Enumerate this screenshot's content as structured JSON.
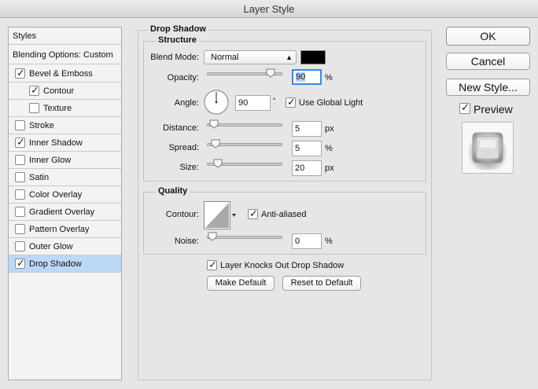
{
  "window": {
    "title": "Layer Style"
  },
  "styles_panel": {
    "header": "Styles",
    "blending": "Blending Options: Custom",
    "items": [
      {
        "label": "Bevel & Emboss",
        "checked": true
      },
      {
        "label": "Contour",
        "checked": true
      },
      {
        "label": "Texture",
        "checked": false
      },
      {
        "label": "Stroke",
        "checked": false
      },
      {
        "label": "Inner Shadow",
        "checked": true
      },
      {
        "label": "Inner Glow",
        "checked": false
      },
      {
        "label": "Satin",
        "checked": false
      },
      {
        "label": "Color Overlay",
        "checked": false
      },
      {
        "label": "Gradient Overlay",
        "checked": false
      },
      {
        "label": "Pattern Overlay",
        "checked": false
      },
      {
        "label": "Outer Glow",
        "checked": false
      },
      {
        "label": "Drop Shadow",
        "checked": true,
        "selected": true
      }
    ]
  },
  "drop_shadow": {
    "title": "Drop Shadow",
    "structure": {
      "title": "Structure",
      "blend_mode_label": "Blend Mode:",
      "blend_mode_value": "Normal",
      "shadow_color": "#000000",
      "opacity_label": "Opacity:",
      "opacity_value": "90",
      "opacity_unit": "%",
      "angle_label": "Angle:",
      "angle_value": "90",
      "angle_unit": "°",
      "use_global_light_label": "Use Global Light",
      "use_global_light_checked": true,
      "distance_label": "Distance:",
      "distance_value": "5",
      "distance_unit": "px",
      "spread_label": "Spread:",
      "spread_value": "5",
      "spread_unit": "%",
      "size_label": "Size:",
      "size_value": "20",
      "size_unit": "px"
    },
    "quality": {
      "title": "Quality",
      "contour_label": "Contour:",
      "anti_aliased_label": "Anti-aliased",
      "anti_aliased_checked": true,
      "noise_label": "Noise:",
      "noise_value": "0",
      "noise_unit": "%"
    },
    "knockout_label": "Layer Knocks Out Drop Shadow",
    "knockout_checked": true,
    "make_default_label": "Make Default",
    "reset_default_label": "Reset to Default"
  },
  "actions": {
    "ok_label": "OK",
    "cancel_label": "Cancel",
    "new_style_label": "New Style...",
    "preview_label": "Preview",
    "preview_checked": true
  },
  "colors": {
    "selection": "#bcd8f7",
    "field_focus": "#3b84f5"
  }
}
